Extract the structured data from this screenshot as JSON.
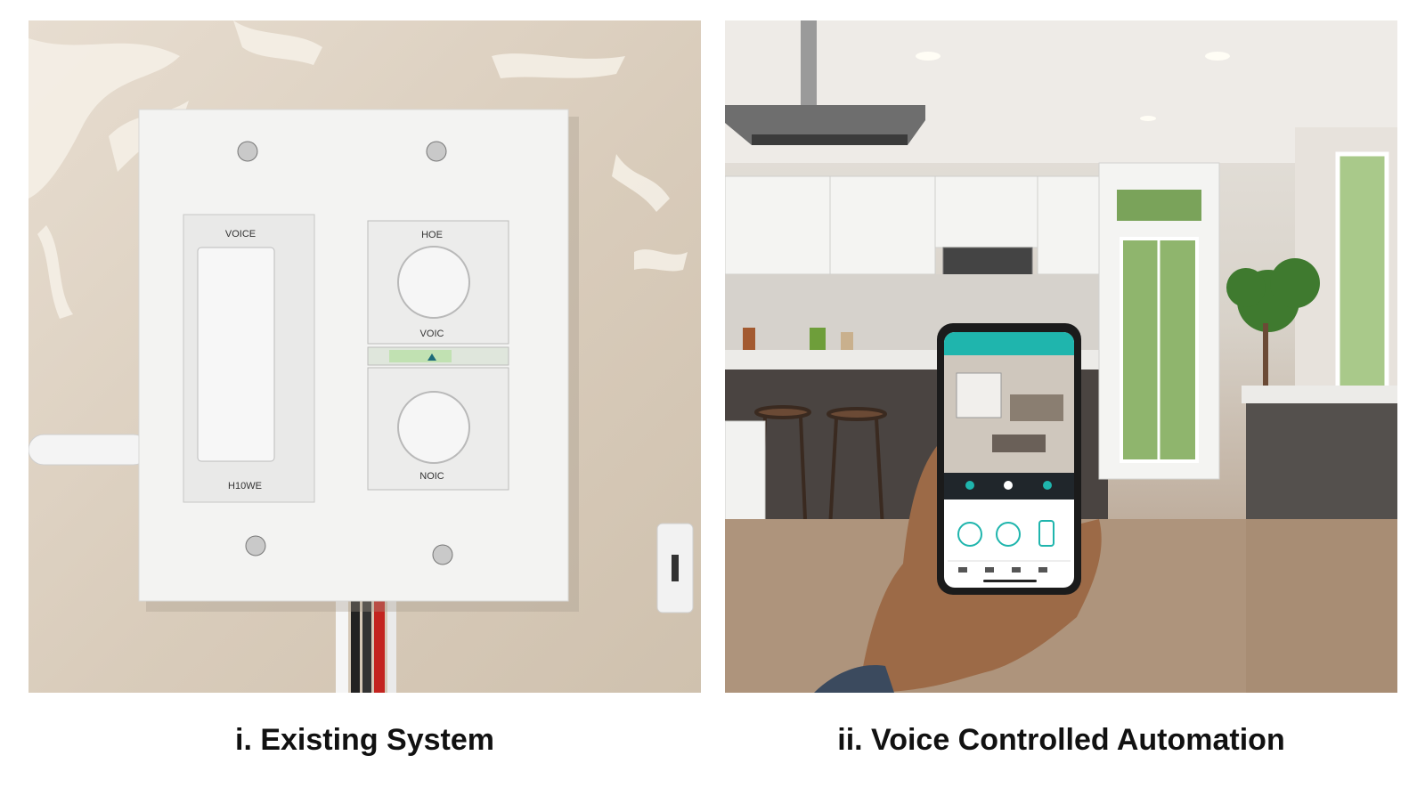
{
  "captions": {
    "left": "i. Existing System",
    "right": "ii. Voice Controlled Automation"
  },
  "switch_panel": {
    "left_switch_top_label": "VOICE",
    "left_switch_bottom_label": "H10WE",
    "right_top_label": "HOE",
    "right_middle_label": "VOIC",
    "right_bottom_label": "NOIC"
  },
  "colors": {
    "wall": "#d9ccbb",
    "plate": "#f3f3f2",
    "app_accent": "#1fb5ad",
    "kitchen_cabinets": "#f4f4f2",
    "island": "#4a4441"
  }
}
